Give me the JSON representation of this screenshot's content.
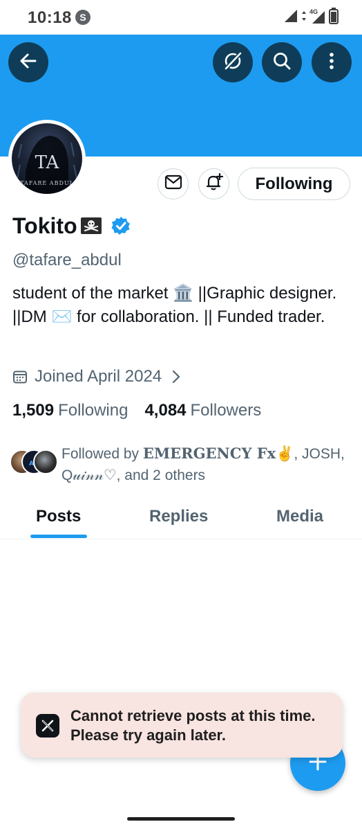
{
  "status_bar": {
    "time": "10:18",
    "app_icon_letter": "S",
    "network_label": "4G"
  },
  "header": {
    "back_icon": "arrow-left-icon",
    "grok_icon": "grok-icon",
    "search_icon": "search-icon",
    "more_icon": "more-vertical-icon",
    "banner_color": "#1d9bf0"
  },
  "avatar": {
    "monogram": "TA",
    "caption": "TAFARE ABDUL"
  },
  "profile_actions": {
    "message_icon": "mail-icon",
    "notify_icon": "bell-plus-icon",
    "follow_state_label": "Following"
  },
  "profile": {
    "display_name": "Tokito",
    "name_emoji": "pirate-flag-icon",
    "verified_icon": "verified-badge-icon",
    "handle": "@tafare_abdul",
    "bio_parts": {
      "part1": "student of the market ",
      "emoji1": "🏛️",
      "part2": "  ||Graphic designer. ||DM ",
      "emoji2": "✉️",
      "part3": " for collaboration. || Funded trader."
    },
    "joined": "Joined April 2024"
  },
  "stats": {
    "following_count": "1,509",
    "following_label": "Following",
    "followers_count": "4,084",
    "followers_label": "Followers"
  },
  "followed_by": {
    "prefix": "Followed by ",
    "name1": "𝐄𝐌𝐄𝐑𝐆𝐄𝐍𝐂𝐘 𝐅𝐱",
    "emoji1": "✌️",
    "separator1": ", JOSH,",
    "name2": "Q𝓊𝒾𝓃𝓃",
    "emoji2": "♡",
    "suffix": ", and 2 others"
  },
  "tabs": [
    {
      "label": "Posts",
      "active": true
    },
    {
      "label": "Replies",
      "active": false
    },
    {
      "label": "Media",
      "active": false
    }
  ],
  "toast": {
    "logo_icon": "x-logo-icon",
    "message": "Cannot retrieve posts at this time. Please try again later."
  },
  "fab": {
    "icon": "plus-icon"
  },
  "colors": {
    "accent": "#1d9bf0",
    "dark_button": "#0f3d59",
    "secondary_text": "#536471",
    "toast_bg": "#f8e4e1"
  }
}
